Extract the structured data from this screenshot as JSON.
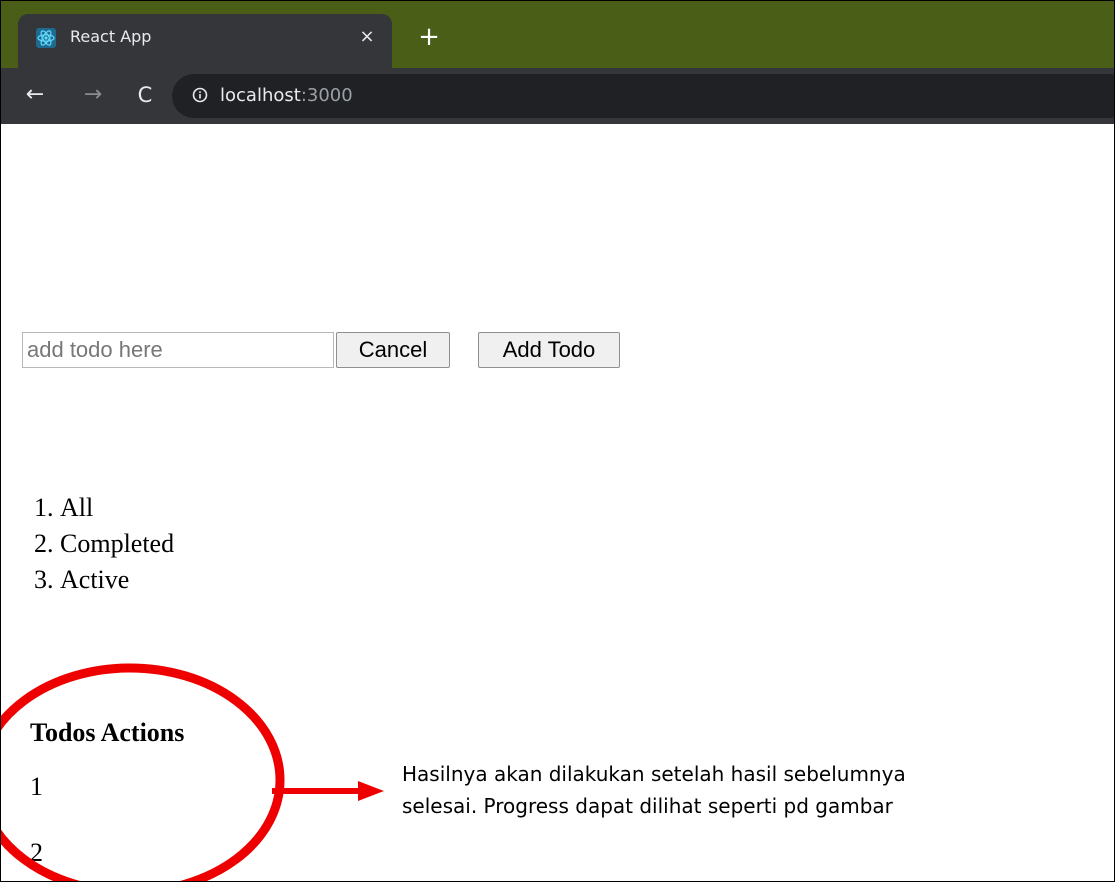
{
  "browser": {
    "tab_title": "React App",
    "close_glyph": "×",
    "new_tab_glyph": "+",
    "back_glyph": "←",
    "forward_glyph": "→",
    "reload_glyph": "C",
    "url_host": "localhost",
    "url_port": ":3000",
    "accent_color": "#4a5e18"
  },
  "form": {
    "input_placeholder": "add todo here",
    "input_value": "",
    "cancel_label": "Cancel",
    "add_label": "Add Todo"
  },
  "filters": [
    "All",
    "Completed",
    "Active"
  ],
  "actions": {
    "title": "Todos Actions",
    "items": [
      "1",
      "2"
    ]
  },
  "annotation": {
    "text_line1": "Hasilnya akan dilakukan setelah hasil sebelumnya",
    "text_line2": "selesai. Progress dapat dilihat seperti pd gambar",
    "color": "#ee0000"
  }
}
